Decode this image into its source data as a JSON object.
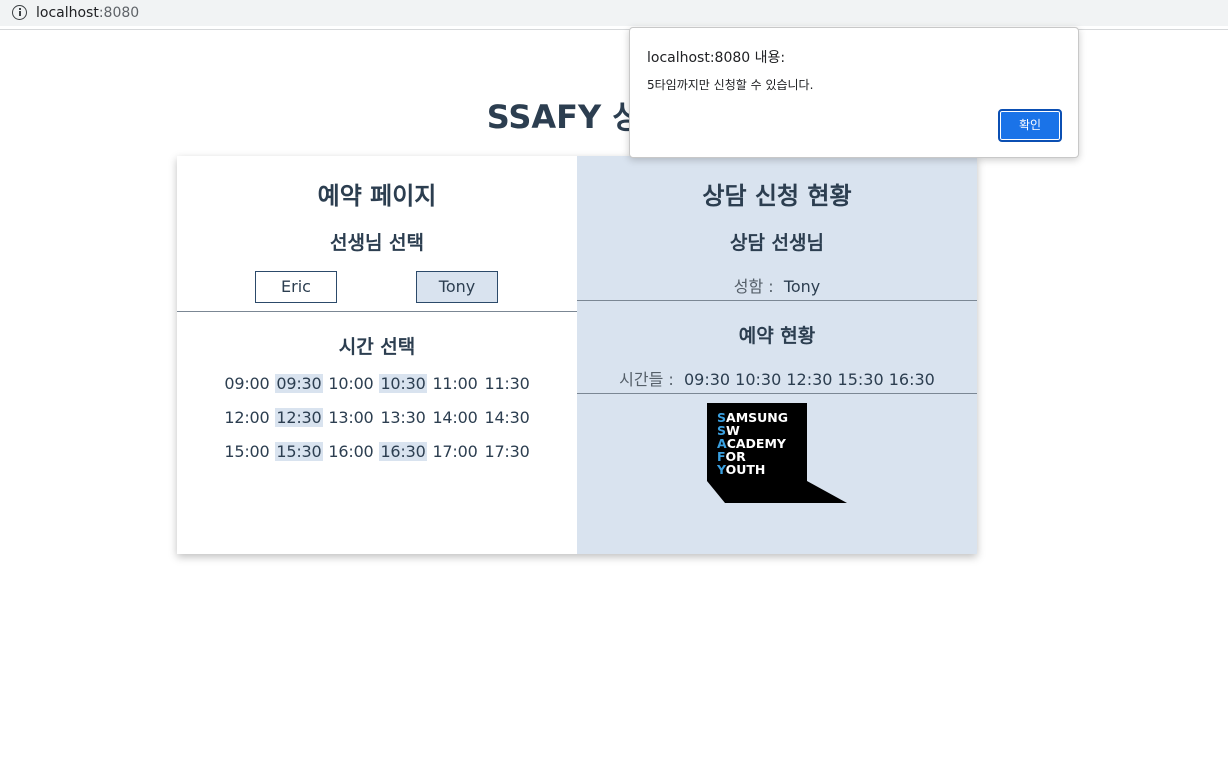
{
  "browser": {
    "url_host": "localhost",
    "url_port": ":8080"
  },
  "page": {
    "title": "SSAFY 상담 예약"
  },
  "reservation": {
    "heading": "예약 페이지",
    "teacher_heading": "선생님 선택",
    "teachers": [
      {
        "name": "Eric",
        "selected": false
      },
      {
        "name": "Tony",
        "selected": true
      }
    ],
    "time_heading": "시간 선택",
    "time_rows": [
      [
        {
          "t": "09:00",
          "sel": false
        },
        {
          "t": "09:30",
          "sel": true
        },
        {
          "t": "10:00",
          "sel": false
        },
        {
          "t": "10:30",
          "sel": true
        },
        {
          "t": "11:00",
          "sel": false
        },
        {
          "t": "11:30",
          "sel": false
        }
      ],
      [
        {
          "t": "12:00",
          "sel": false
        },
        {
          "t": "12:30",
          "sel": true
        },
        {
          "t": "13:00",
          "sel": false
        },
        {
          "t": "13:30",
          "sel": false
        },
        {
          "t": "14:00",
          "sel": false
        },
        {
          "t": "14:30",
          "sel": false
        }
      ],
      [
        {
          "t": "15:00",
          "sel": false
        },
        {
          "t": "15:30",
          "sel": true
        },
        {
          "t": "16:00",
          "sel": false
        },
        {
          "t": "16:30",
          "sel": true
        },
        {
          "t": "17:00",
          "sel": false
        },
        {
          "t": "17:30",
          "sel": false
        }
      ]
    ]
  },
  "status": {
    "heading": "상담 신청 현황",
    "teacher_heading": "상담 선생님",
    "name_label": "성함 :",
    "name_value": "Tony",
    "reservation_heading": "예약 현황",
    "times_label": "시간들 :",
    "times_value": "09:30 10:30 12:30 15:30 16:30"
  },
  "logo": {
    "lines": [
      {
        "first": "S",
        "rest": "AMSUNG"
      },
      {
        "first": "S",
        "rest": "W"
      },
      {
        "first": "A",
        "rest": "CADEMY"
      },
      {
        "first": "F",
        "rest": "OR"
      },
      {
        "first": "Y",
        "rest": "OUTH"
      }
    ],
    "accent_color": "#3aa0e0"
  },
  "alert": {
    "title": "localhost:8080 내용:",
    "message": "5타임까지만 신청할 수 있습니다.",
    "ok_label": "확인"
  },
  "colors": {
    "text": "#2c3e50",
    "panel_bg": "#d9e3ef",
    "button_blue": "#1a73e8"
  }
}
